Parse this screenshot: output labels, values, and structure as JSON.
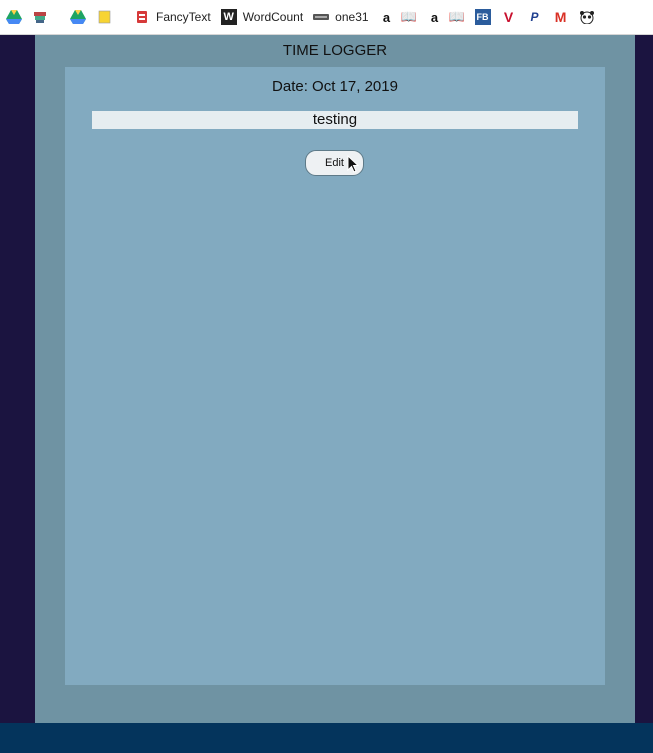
{
  "bookmarks": [
    {
      "icon": "google-drive-icon",
      "label": ""
    },
    {
      "icon": "stack-icon",
      "label": ""
    },
    {
      "icon": "google-drive-icon",
      "label": ""
    },
    {
      "icon": "keep-note-icon",
      "label": ""
    },
    {
      "icon": "fancytext-icon",
      "label": "FancyText"
    },
    {
      "icon": "wordcount-w-icon",
      "label": "WordCount"
    },
    {
      "icon": "one31-icon",
      "label": "one31"
    },
    {
      "icon": "amazon-icon",
      "label": ""
    },
    {
      "icon": "book-icon",
      "label": ""
    },
    {
      "icon": "amazon-icon",
      "label": ""
    },
    {
      "icon": "book-icon",
      "label": ""
    },
    {
      "icon": "fb-icon",
      "label": ""
    },
    {
      "icon": "v-icon",
      "label": ""
    },
    {
      "icon": "paypal-icon",
      "label": ""
    },
    {
      "icon": "gmail-icon",
      "label": ""
    },
    {
      "icon": "panda-icon",
      "label": ""
    }
  ],
  "app": {
    "title": "TIME LOGGER",
    "date_line": "Date: Oct 17, 2019",
    "entry_text": "testing",
    "edit_label": "Edit"
  },
  "colors": {
    "page_bg": "#1b1440",
    "outer_panel": "#6f93a3",
    "inner_panel": "#82aac0",
    "entry_bg": "#e6edf0",
    "footer_bar": "#04345c"
  }
}
